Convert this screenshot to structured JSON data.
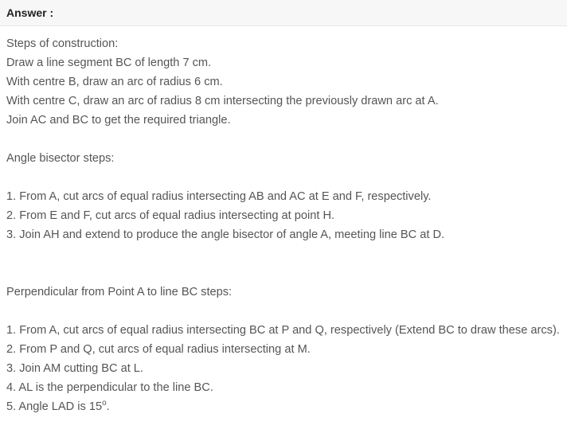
{
  "header": {
    "answer_label": "Answer :"
  },
  "construction": {
    "heading": "Steps of construction:",
    "steps": [
      "Draw a line segment BC of length 7 cm.",
      "With centre B, draw an arc of radius 6 cm.",
      "With centre C, draw an arc of radius 8 cm intersecting the previously drawn arc at A.",
      "Join AC and BC to get the required triangle."
    ]
  },
  "bisector": {
    "heading": "Angle bisector steps:",
    "steps": [
      "1. From A, cut arcs of equal radius intersecting AB and AC at E and F, respectively.",
      "2. From E and F, cut arcs of equal radius intersecting at point H.",
      "3. Join AH and extend to produce the angle bisector of angle A, meeting line BC at D."
    ]
  },
  "perpendicular": {
    "heading": "Perpendicular from Point A to line BC steps:",
    "steps": [
      "1. From A, cut arcs of equal radius intersecting BC at P and Q, respectively (Extend BC to draw these arcs).",
      "2. From P and Q, cut arcs of equal radius intersecting at M.",
      "3. Join AM cutting BC at L.",
      "4. AL is the perpendicular to the line BC."
    ],
    "final_step_text": "5. Angle LAD is 15",
    "final_step_superscript": "o",
    "final_step_end": "."
  }
}
